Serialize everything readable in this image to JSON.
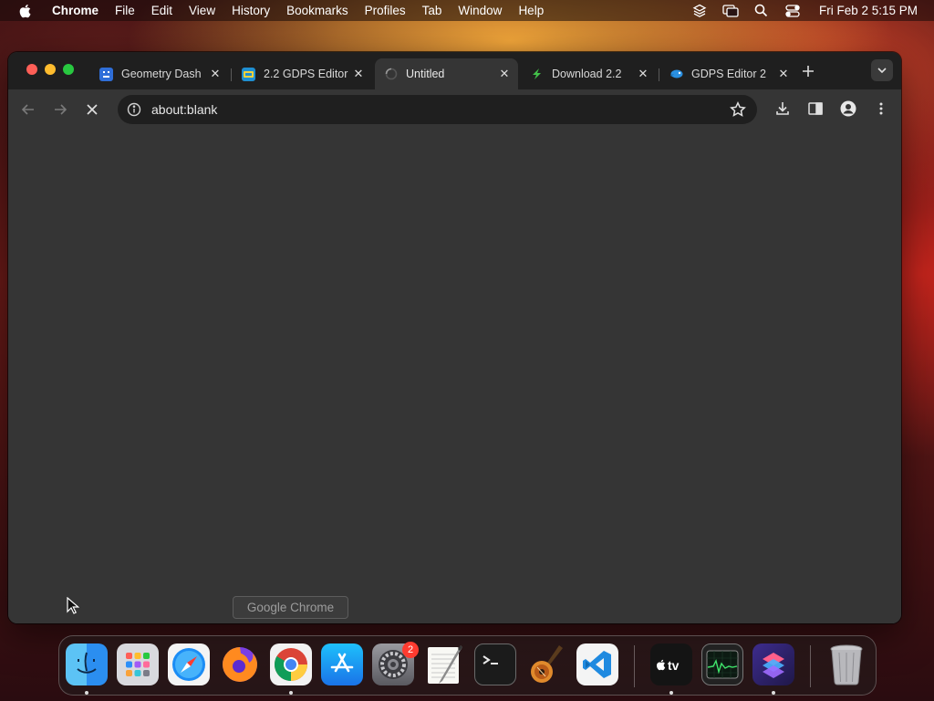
{
  "menubar": {
    "app_name": "Chrome",
    "items": [
      "File",
      "Edit",
      "View",
      "History",
      "Bookmarks",
      "Profiles",
      "Tab",
      "Window",
      "Help"
    ],
    "clock": "Fri Feb 2  5:15 PM",
    "status_icons": [
      "layers-icon",
      "screen-mirroring-icon",
      "spotlight-search-icon",
      "control-center-icon"
    ]
  },
  "browser": {
    "tabs": [
      {
        "title": "Geometry Dash",
        "icon": "geometry-dash-favicon",
        "active": false
      },
      {
        "title": "2.2 GDPS Editor",
        "icon": "gdps-favicon",
        "active": false
      },
      {
        "title": "Untitled",
        "icon": "loading-spinner-icon",
        "active": true
      },
      {
        "title": "Download 2.2",
        "icon": "green-leaf-favicon",
        "active": false
      },
      {
        "title": "GDPS Editor 2",
        "icon": "blue-bird-favicon",
        "active": false
      }
    ],
    "address": "about:blank",
    "accent": "#1f1f1f"
  },
  "tooltip": {
    "text": "Google Chrome"
  },
  "dock": {
    "apps": [
      "Finder",
      "Launchpad",
      "Safari",
      "Firefox",
      "Google Chrome",
      "App Store",
      "System Settings",
      "TextEdit",
      "Terminal",
      "GarageBand",
      "Visual Studio Code",
      "Apple TV",
      "Activity Monitor",
      "Shortcuts",
      "Trash"
    ],
    "settings_badge": "2"
  }
}
